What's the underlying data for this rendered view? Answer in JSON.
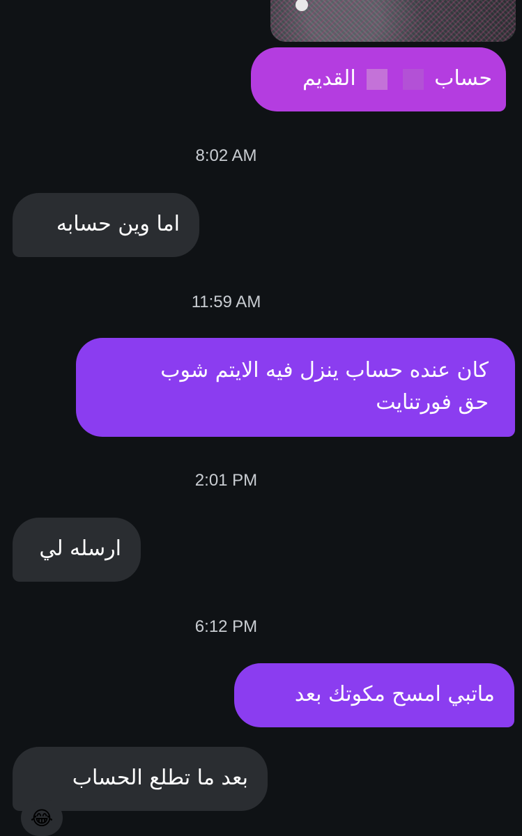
{
  "messages": [
    {
      "type": "sent",
      "text_right": "حساب",
      "text_left": "القديم"
    },
    {
      "type": "timestamp",
      "text": "8:02 AM"
    },
    {
      "type": "received",
      "text": "اما وين حسابه"
    },
    {
      "type": "timestamp",
      "text": "11:59 AM"
    },
    {
      "type": "sent",
      "line1": "كان عنده حساب ينزل فيه الايتم شوب",
      "line2": "حق فورتنايت"
    },
    {
      "type": "timestamp",
      "text": "2:01 PM"
    },
    {
      "type": "received",
      "text": "ارسله لي"
    },
    {
      "type": "timestamp",
      "text": "6:12 PM"
    },
    {
      "type": "sent",
      "text": "ماتبي امسح مكوتك بعد"
    },
    {
      "type": "received",
      "text": "بعد ما تطلع الحساب"
    }
  ],
  "reaction": "😂",
  "colors": {
    "background": "#0f1215",
    "sent_bubble": "#8b3df0",
    "sent_bubble_highlight": "#b43de0",
    "received_bubble": "#2a2d31",
    "timestamp_text": "#c9cdd2"
  }
}
